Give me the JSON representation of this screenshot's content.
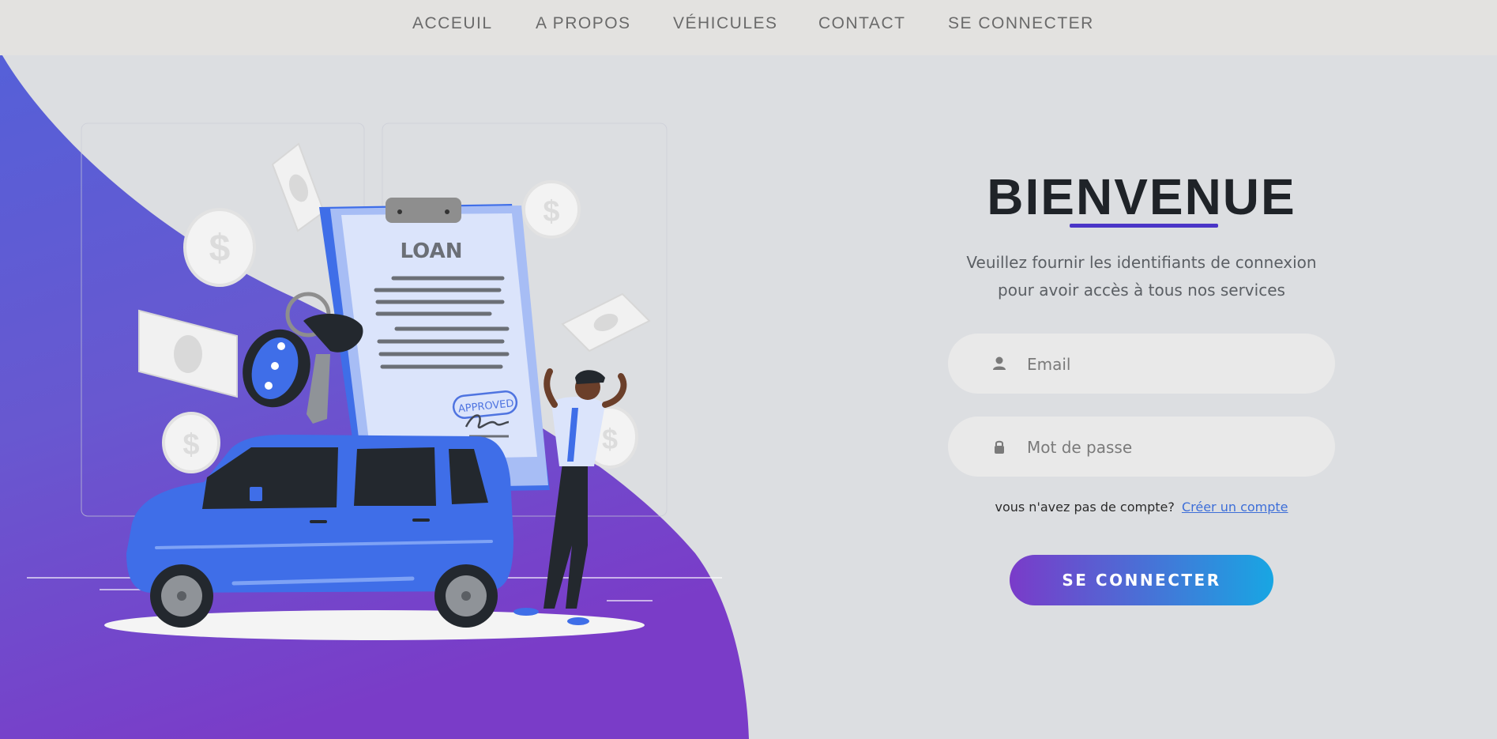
{
  "nav": {
    "items": [
      {
        "label": "ACCEUIL"
      },
      {
        "label": "A PROPOS"
      },
      {
        "label": "VÉHICULES"
      },
      {
        "label": "CONTACT"
      },
      {
        "label": "SE CONNECTER"
      }
    ]
  },
  "hero": {
    "document_title": "LOAN",
    "stamp_text": "APPROVED",
    "currency_symbol": "$"
  },
  "login": {
    "title": "BIENVENUE",
    "subtitle_line1": "Veuillez fournir les identifiants de connexion",
    "subtitle_line2": "pour avoir accès à tous nos services",
    "email_placeholder": "Email",
    "password_placeholder": "Mot de passe",
    "no_account_text": "vous n'avez pas de compte?",
    "create_account_link": "Créer un compte",
    "submit_label": "SE CONNECTER"
  },
  "colors": {
    "accent_purple": "#7b3fc8",
    "accent_blue": "#18a6e3",
    "title_underline": "#4a35c7",
    "link": "#3d6ed8"
  }
}
